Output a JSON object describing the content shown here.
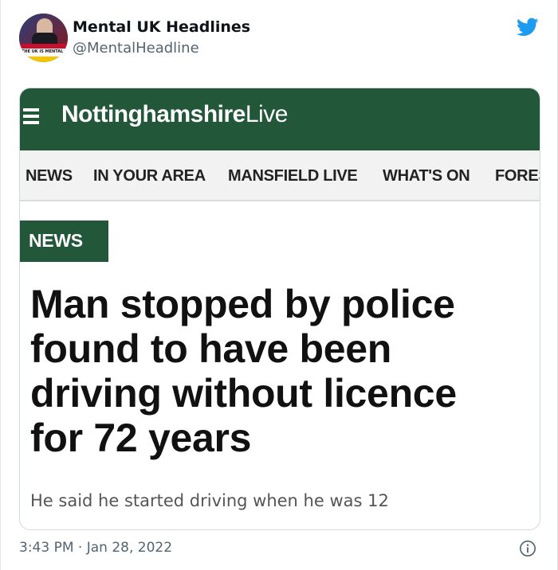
{
  "tweet": {
    "display_name": "Mental UK Headlines",
    "handle": "@MentalHeadline",
    "avatar": {
      "ticker_text": "THE UK IS MENTAL",
      "icon": "news-anchor-avatar"
    },
    "platform_icon": "twitter-bird-icon",
    "timestamp": "3:43 PM · Jan 28, 2022",
    "info_icon": "info-icon"
  },
  "article": {
    "brand_bold": "Nottinghamshire",
    "brand_light": "Live",
    "nav_items": [
      "NEWS",
      "IN YOUR AREA",
      "MANSFIELD LIVE",
      "WHAT'S ON",
      "FORES"
    ],
    "section_tag": "NEWS",
    "headline_lines": [
      "Man stopped by police",
      "found to have been",
      "driving without licence",
      "for 72 years"
    ],
    "subheadline": "He said he started driving when he was 12"
  },
  "colors": {
    "brand_green": "#22573a",
    "twitter_blue": "#1d9bf0",
    "muted_text": "#536471"
  }
}
